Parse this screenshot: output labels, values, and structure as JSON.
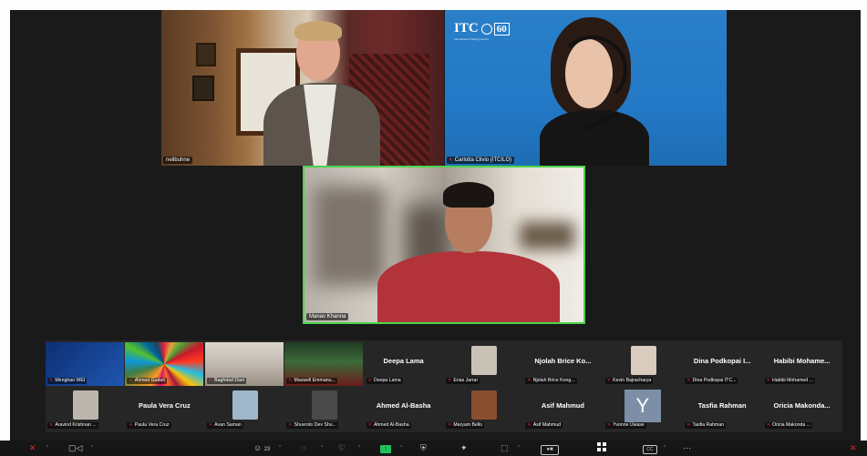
{
  "main_speakers": [
    {
      "name": "neilbuhne",
      "muted": false
    },
    {
      "name": "Carlotta Clivio (ITCILO)",
      "muted": true,
      "logo_text": "ITC",
      "logo_badge": "60",
      "logo_sub": "International Training Centre"
    },
    {
      "name": "Manav Khanna",
      "muted": false
    }
  ],
  "gallery": {
    "row1": [
      {
        "name": "Menghao WEI",
        "muted": true,
        "type": "image",
        "img": "img-1"
      },
      {
        "name": "Ahmed Gudah",
        "muted": true,
        "type": "image",
        "img": "img-2"
      },
      {
        "name": "Baghdad Daei",
        "muted": true,
        "type": "image",
        "img": "img-3"
      },
      {
        "name": "Maxwell Emmanu...",
        "muted": true,
        "type": "image",
        "img": "img-4"
      },
      {
        "name": "Deepa Lama",
        "display": "Deepa Lama",
        "muted": true,
        "type": "text"
      },
      {
        "name": "Enas Jarrar",
        "muted": true,
        "type": "avatar",
        "color": "#c8c2b6"
      },
      {
        "name": "Njolah Brice Kong...",
        "display": "Njolah Brice Ko...",
        "muted": true,
        "type": "text"
      },
      {
        "name": "Kevin Bajracharya",
        "muted": true,
        "type": "avatar",
        "color": "#d9cbbd"
      },
      {
        "name": "Dina Podkopai ITC...",
        "display": "Dina Podkopai I...",
        "muted": true,
        "type": "text"
      },
      {
        "name": "Habibi Mohamed ...",
        "display": "Habibi Mohame...",
        "muted": true,
        "type": "text"
      }
    ],
    "row2": [
      {
        "name": "Aravind Krishnan ...",
        "muted": true,
        "type": "avatar",
        "color": "#bcb6ad"
      },
      {
        "name": "Paula Vera Cruz",
        "display": "Paula Vera Cruz",
        "muted": true,
        "type": "text"
      },
      {
        "name": "Avan Saman",
        "muted": true,
        "type": "avatar",
        "color": "#9fb7c9"
      },
      {
        "name": "Shuvroto Dev Shu...",
        "muted": true,
        "type": "avatar",
        "color": "#4a4a4a"
      },
      {
        "name": "Ahmed Al-Basha",
        "display": "Ahmed Al-Basha",
        "muted": true,
        "type": "text"
      },
      {
        "name": "Maryam Bello",
        "muted": true,
        "type": "avatar",
        "color": "#8a4f2f"
      },
      {
        "name": "Asif Mahmud",
        "display": "Asif Mahmud",
        "muted": true,
        "type": "text"
      },
      {
        "name": "Yvonne Uwase",
        "muted": true,
        "type": "letter",
        "letter": "Y"
      },
      {
        "name": "Tasfia Rahman",
        "display": "Tasfia Rahman",
        "muted": true,
        "type": "text"
      },
      {
        "name": "Oricia Makonda ...",
        "display": "Oricia Makonda...",
        "muted": true,
        "type": "text"
      }
    ]
  },
  "toolbar": {
    "participants_count": "23"
  }
}
